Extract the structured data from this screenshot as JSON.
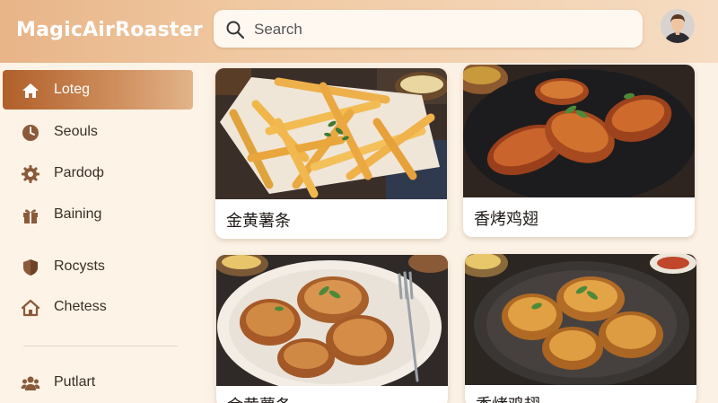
{
  "app": {
    "title": "MagicAirRoaster"
  },
  "search": {
    "placeholder": "Search"
  },
  "sidebar": {
    "items": [
      {
        "label": "Loteg",
        "icon": "home-icon",
        "active": true
      },
      {
        "label": "Seouls",
        "icon": "clock-icon",
        "active": false
      },
      {
        "label": "Pardoф",
        "icon": "gear-icon",
        "active": false
      },
      {
        "label": "Baining",
        "icon": "gift-icon",
        "active": false
      },
      {
        "label": "Rocysts",
        "icon": "shield-icon",
        "active": false
      },
      {
        "label": "Chetess",
        "icon": "house-icon",
        "active": false
      },
      {
        "label": "Putlart",
        "icon": "group-icon",
        "active": false
      }
    ]
  },
  "recipes": [
    {
      "title": "金黄薯条",
      "image": "french-fries"
    },
    {
      "title": "香烤鸡翅",
      "image": "roasted-chicken-wings"
    },
    {
      "title": "金黄薯条",
      "image": "roasted-chicken-plate"
    },
    {
      "title": "香烤鸡翅",
      "image": "roasted-chicken-pan"
    }
  ],
  "colors": {
    "accent": "#c0703a",
    "header_start": "#e8b488",
    "background": "#fbf1e4"
  }
}
